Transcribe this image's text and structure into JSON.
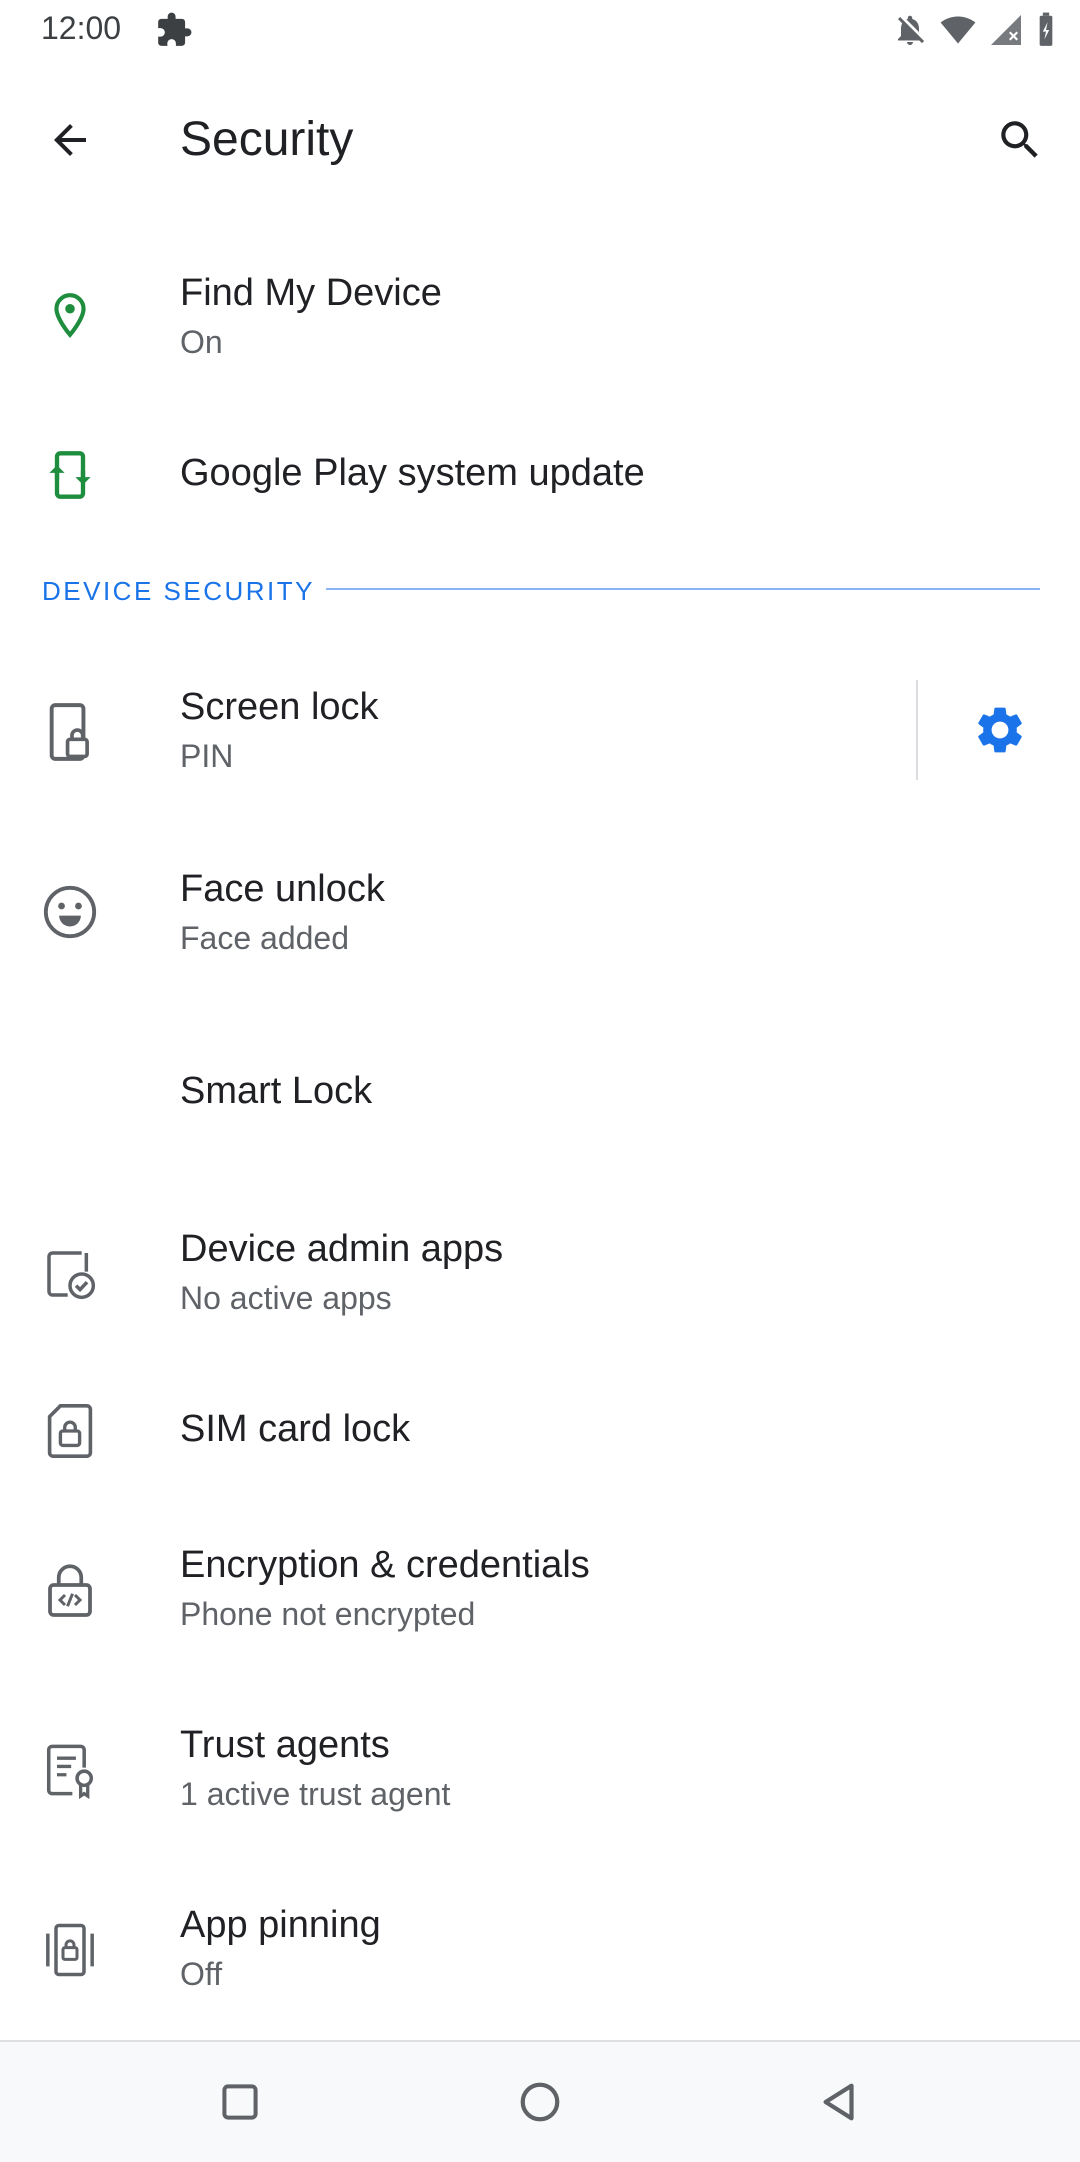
{
  "status_bar": {
    "time": "12:00",
    "icons": [
      "puzzle-icon",
      "notifications-off-icon",
      "wifi-icon",
      "signal-icon",
      "battery-charging-icon"
    ]
  },
  "app_bar": {
    "title": "Security",
    "back_icon": "arrow-back-icon",
    "search_icon": "search-icon"
  },
  "items_top": [
    {
      "title": "Find My Device",
      "summary": "On",
      "icon": "location-pin-icon"
    },
    {
      "title": "Google Play system update",
      "summary": "",
      "icon": "system-update-icon"
    }
  ],
  "section": {
    "label": "DEVICE SECURITY"
  },
  "items": [
    {
      "title": "Screen lock",
      "summary": "PIN",
      "icon": "phone-lock-icon",
      "trailing_icon": "settings-gear-icon"
    },
    {
      "title": "Face unlock",
      "summary": "Face added",
      "icon": "face-icon"
    },
    {
      "title": "Smart Lock",
      "summary": "",
      "icon": ""
    },
    {
      "title": "Device admin apps",
      "summary": "No active apps",
      "icon": "device-admin-icon"
    },
    {
      "title": "SIM card lock",
      "summary": "",
      "icon": "sim-lock-icon"
    },
    {
      "title": "Encryption & credentials",
      "summary": "Phone not encrypted",
      "icon": "encryption-lock-icon"
    },
    {
      "title": "Trust agents",
      "summary": "1 active trust agent",
      "icon": "trust-agent-icon"
    },
    {
      "title": "App pinning",
      "summary": "Off",
      "icon": "app-pinning-icon"
    }
  ],
  "nav_bar": {
    "icons": [
      "recents-square-icon",
      "home-circle-icon",
      "back-triangle-icon"
    ]
  },
  "colors": {
    "accent": "#1a73e8",
    "green": "#1e8e3e",
    "text_primary": "#202124",
    "text_secondary": "#5f6368"
  }
}
